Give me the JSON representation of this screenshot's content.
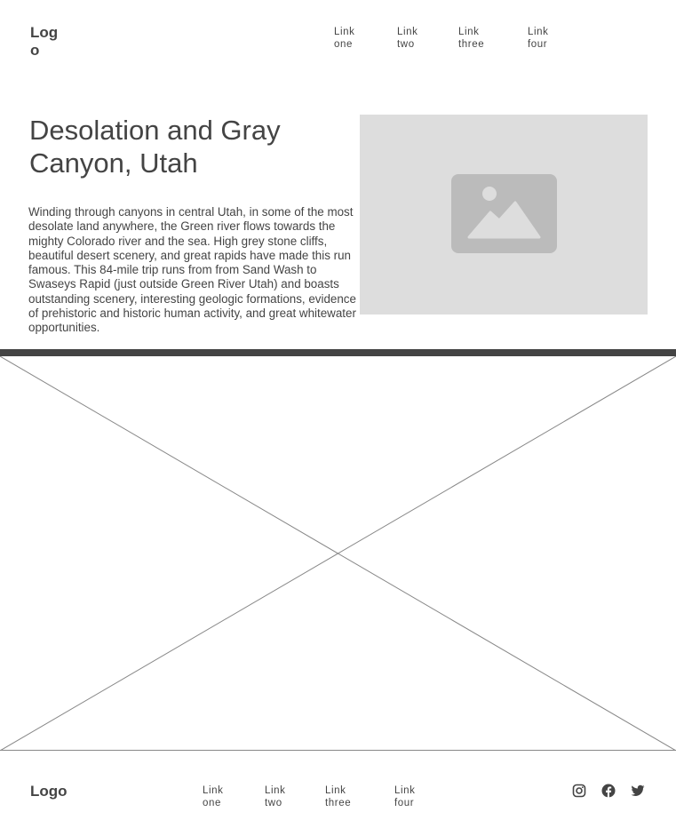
{
  "header": {
    "logo": "Logo",
    "nav": [
      {
        "line1": "Link",
        "line2": "one"
      },
      {
        "line1": "Link",
        "line2": "two"
      },
      {
        "line1": "Link",
        "line2": "three"
      },
      {
        "line1": "Link",
        "line2": "four"
      }
    ]
  },
  "hero": {
    "title": "Desolation and Gray Canyon, Utah",
    "body": "Winding through canyons in central Utah, in some of the most desolate land anywhere, the Green river flows towards the mighty Colorado river and the sea. High grey stone cliffs, beautiful desert scenery, and great rapids have made this run famous. This 84-mile trip runs from from Sand Wash to Swaseys Rapid (just outside Green River Utah) and boasts outstanding scenery, interesting geologic formations, evidence of prehistoric and historic human activity, and great whitewater opportunities.",
    "image_icon": "image-placeholder-icon"
  },
  "footer": {
    "logo": "Logo",
    "nav": [
      {
        "line1": "Link",
        "line2": "one"
      },
      {
        "line1": "Link",
        "line2": "two"
      },
      {
        "line1": "Link",
        "line2": "three"
      },
      {
        "line1": "Link",
        "line2": "four"
      }
    ],
    "social_icons": [
      "instagram-icon",
      "facebook-icon",
      "twitter-icon"
    ]
  },
  "colors": {
    "text": "#444444",
    "placeholder_bg": "#dddddd",
    "placeholder_icon": "#bbbbbb",
    "divider": "#444444"
  }
}
